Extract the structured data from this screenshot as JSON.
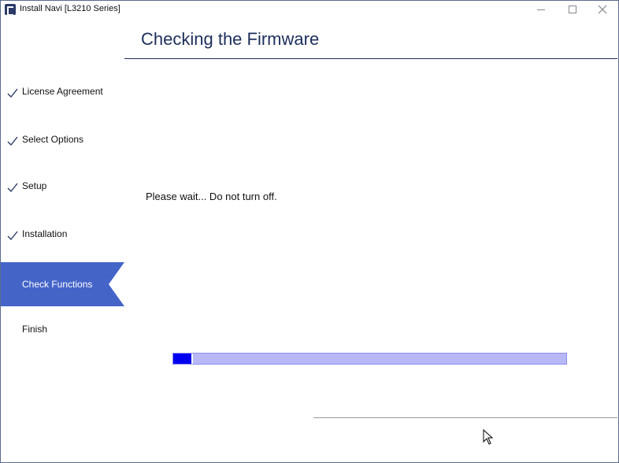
{
  "window": {
    "title": "Install Navi [L3210 Series]"
  },
  "header": {
    "title": "Checking the Firmware"
  },
  "sidebar": {
    "steps": [
      {
        "label": "License Agreement",
        "state": "done"
      },
      {
        "label": "Select Options",
        "state": "done"
      },
      {
        "label": "Setup",
        "state": "done"
      },
      {
        "label": "Installation",
        "state": "done"
      },
      {
        "label": "Check Functions",
        "state": "active"
      },
      {
        "label": "Finish",
        "state": "pending"
      }
    ]
  },
  "main": {
    "message": "Please wait... Do not turn off.",
    "progress": 0.05
  },
  "colors": {
    "accent": "#4464c8",
    "title": "#1d2f5c",
    "progress_fill": "#0000f0",
    "progress_track": "#b8b8f6"
  }
}
